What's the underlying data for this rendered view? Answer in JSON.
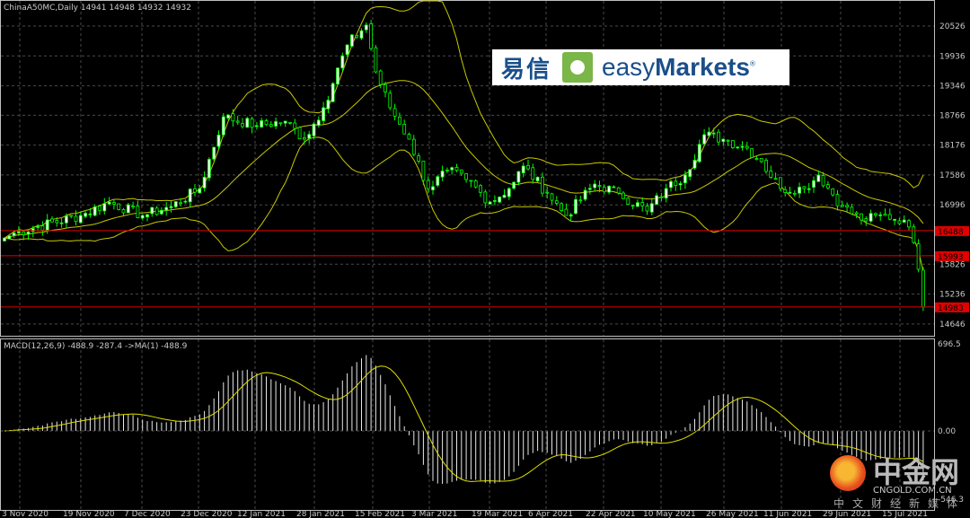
{
  "header": {
    "symbol": "ChinaA50MC,Daily",
    "ohlc": "14941 14948 14932 14932"
  },
  "macd_label": "MACD(12,26,9) -488.9 -287.4  ->MA(1) -488.9",
  "logo": {
    "cn": "易信",
    "en_light": "easy",
    "en_bold": "Markets",
    "reg": "®"
  },
  "watermark": {
    "name": "中金网",
    "domain": "CNGOLD.COM.CN",
    "tagline": "中文财经新媒体"
  },
  "colors": {
    "candle": "#00ff00",
    "band": "#c8c800",
    "hline": "#e00000",
    "grid": "#4a4a4a",
    "macd": "#ffffff",
    "signal": "#e0e000"
  },
  "price_levels": [
    {
      "label": "16488",
      "value": 16488
    },
    {
      "label": "15993",
      "value": 15993
    },
    {
      "label": "14983",
      "value": 14983
    }
  ],
  "chart_data": {
    "type": "candlestick",
    "title": "ChinaA50MC,Daily",
    "ylim": [
      14400,
      21000
    ],
    "y_ticks": [
      "20526",
      "19936",
      "19346",
      "18766",
      "18176",
      "17586",
      "16996",
      "15826",
      "15236",
      "14646"
    ],
    "x_ticks": [
      "3 Nov 2020",
      "19 Nov 2020",
      "7 Dec 2020",
      "23 Dec 2020",
      "12 Jan 2021",
      "28 Jan 2021",
      "15 Feb 2021",
      "3 Mar 2021",
      "19 Mar 2021",
      "6 Apr 2021",
      "22 Apr 2021",
      "10 May 2021",
      "26 May 2021",
      "11 Jun 2021",
      "29 Jun 2021",
      "15 Jul 2021"
    ],
    "close_anchors": [
      [
        0,
        16344
      ],
      [
        3,
        16468
      ],
      [
        16,
        16787
      ],
      [
        22,
        17053
      ],
      [
        29,
        16787
      ],
      [
        35,
        16964
      ],
      [
        41,
        17318
      ],
      [
        46,
        18736
      ],
      [
        53,
        18559
      ],
      [
        59,
        18648
      ],
      [
        63,
        18293
      ],
      [
        67,
        18914
      ],
      [
        72,
        20154
      ],
      [
        76,
        20544
      ],
      [
        78,
        19622
      ],
      [
        81,
        18914
      ],
      [
        85,
        18293
      ],
      [
        89,
        17318
      ],
      [
        93,
        17673
      ],
      [
        97,
        17496
      ],
      [
        102,
        17053
      ],
      [
        106,
        17318
      ],
      [
        109,
        17762
      ],
      [
        114,
        17230
      ],
      [
        118,
        16787
      ],
      [
        124,
        17407
      ],
      [
        129,
        17230
      ],
      [
        135,
        16876
      ],
      [
        139,
        17318
      ],
      [
        143,
        17585
      ],
      [
        147,
        18382
      ],
      [
        151,
        18293
      ],
      [
        156,
        18116
      ],
      [
        159,
        17850
      ],
      [
        163,
        17318
      ],
      [
        168,
        17318
      ],
      [
        171,
        17585
      ],
      [
        176,
        16964
      ],
      [
        180,
        16698
      ],
      [
        185,
        16787
      ],
      [
        189,
        16698
      ],
      [
        191,
        16255
      ],
      [
        192,
        15724
      ],
      [
        193,
        14983
      ]
    ],
    "indicators": {
      "bollinger": [
        20,
        2
      ],
      "macd": [
        12,
        26,
        9
      ]
    },
    "macd_axis": {
      "max_label": "696.5",
      "zero_label": "0.00",
      "min_label": "-546.3",
      "max": 696.5,
      "min": -546.3
    }
  }
}
